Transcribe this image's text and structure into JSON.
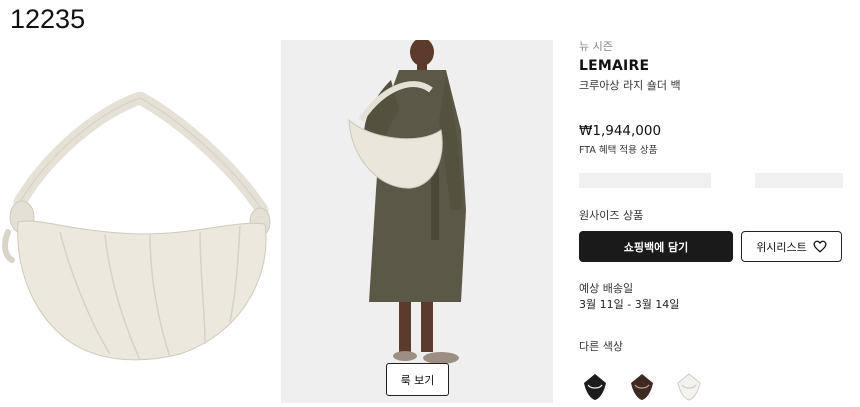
{
  "page": {
    "id_label": "12235"
  },
  "gallery": {
    "look_button_label": "룩 보기"
  },
  "product": {
    "season": "뉴 시즌",
    "brand": "LEMAIRE",
    "name": "크루아상 라지 숄더 백",
    "price": "₩1,944,000",
    "price_note": "FTA 혜택 적용 상품"
  },
  "purchase": {
    "size_label": "원사이즈 상품",
    "cart_button": "쇼핑백에 담기",
    "wishlist_button": "위시리스트"
  },
  "delivery": {
    "label": "예상 배송일",
    "dates": "3월 11일 - 3월 14일"
  },
  "colors": {
    "label": "다른 색상",
    "swatches": [
      {
        "name": "black",
        "color": "#1c1c1c"
      },
      {
        "name": "dark-brown",
        "color": "#3e2a22"
      },
      {
        "name": "white",
        "color": "#f4f3ef"
      }
    ]
  },
  "theme": {
    "primary": "#1a1a1a",
    "bag_color": "#e9e6dc"
  }
}
